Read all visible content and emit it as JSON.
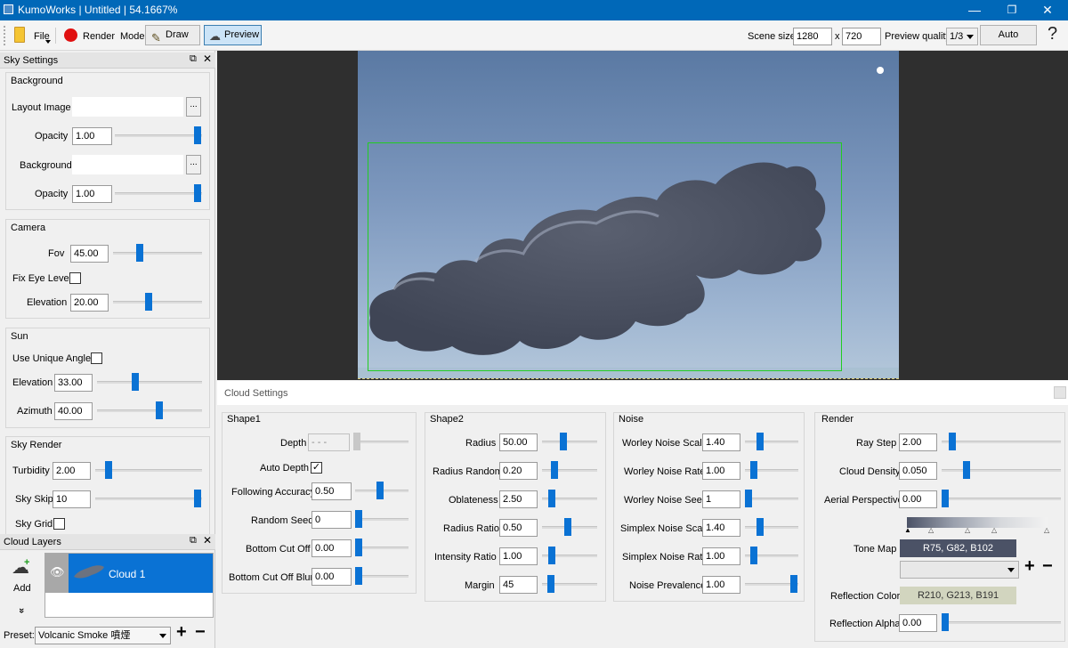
{
  "window": {
    "title": "KumoWorks | Untitled | 54.1667%",
    "minimize": "—",
    "restore": "❐",
    "close": "✕"
  },
  "toolbar": {
    "file": "File",
    "render": "Render",
    "mode_label": "Mode:",
    "draw": "Draw",
    "preview": "Preview",
    "scene_size_label": "Scene size:",
    "scene_width": "1280",
    "scene_x": "x",
    "scene_height": "720",
    "preview_quality_label": "Preview quality:",
    "preview_quality": "1/3",
    "auto": "Auto",
    "help": "?"
  },
  "sky_settings": {
    "title": "Sky Settings",
    "background": {
      "title": "Background",
      "layout_image_label": "Layout Image",
      "layout_image_value": "",
      "browse": "...",
      "opacity1_label": "Opacity",
      "opacity1": "1.00",
      "background_label": "Background",
      "background_value": "",
      "opacity2_label": "Opacity",
      "opacity2": "1.00"
    },
    "camera": {
      "title": "Camera",
      "fov_label": "Fov",
      "fov": "45.00",
      "fov_level": 0.28,
      "fix_eye_label": "Fix Eye Level",
      "fix_eye_checked": false,
      "elevation_label": "Elevation",
      "elevation": "20.00",
      "elevation_level": 0.36
    },
    "sun": {
      "title": "Sun",
      "unique_angles_label": "Use Unique Angles",
      "unique_angles_checked": false,
      "elevation_label": "Elevation",
      "elevation": "33.00",
      "elevation_level": 0.37,
      "azimuth_label": "Azimuth",
      "azimuth": "40.00",
      "azimuth_level": 0.59
    },
    "sky_render": {
      "title": "Sky Render",
      "turbidity_label": "Turbidity",
      "turbidity": "2.00",
      "turbidity_level": 0.1,
      "sky_skip_label": "Sky Skip",
      "sky_skip": "10",
      "sky_skip_level": 1.0,
      "sky_grid_label": "Sky Grid",
      "sky_grid_checked": false
    }
  },
  "cloud_layers": {
    "title": "Cloud Layers",
    "add_label": "Add",
    "expand": "»",
    "layers": [
      {
        "name": "Cloud 1",
        "visible": true
      }
    ],
    "preset_label": "Preset:",
    "preset_value": "Volcanic Smoke 噴煙",
    "plus": "+",
    "minus": "−"
  },
  "cloud_settings": {
    "title": "Cloud Settings",
    "shape1": {
      "title": "Shape1",
      "depth_label": "Depth",
      "depth": "- - -",
      "depth_level": 0.0,
      "auto_depth_label": "Auto Depth",
      "auto_depth_checked": true,
      "following_accuracy_label": "Following Accuracy",
      "following_accuracy": "0.50",
      "following_accuracy_level": 0.5,
      "random_seed_label": "Random Seed",
      "random_seed": "0",
      "random_seed_level": 0.0,
      "bottom_cut_off_label": "Bottom Cut Off",
      "bottom_cut_off": "0.00",
      "bottom_cut_off_level": 0.0,
      "bottom_cut_off_blur_label": "Bottom Cut Off Blur",
      "bottom_cut_off_blur": "0.00",
      "bottom_cut_off_blur_level": 0.0
    },
    "shape2": {
      "title": "Shape2",
      "radius_label": "Radius",
      "radius": "50.00",
      "radius_level": 0.46,
      "radius_random_label": "Radius Random",
      "radius_random": "0.20",
      "radius_random_level": 0.2,
      "oblateness_label": "Oblateness",
      "oblateness": "2.50",
      "oblateness_level": 0.16,
      "radius_ratio_label": "Radius Ratio",
      "radius_ratio": "0.50",
      "radius_ratio_level": 0.5,
      "intensity_ratio_label": "Intensity Ratio",
      "intensity_ratio": "1.00",
      "intensity_ratio_level": 0.16,
      "margin_label": "Margin",
      "margin": "45",
      "margin_level": 0.12
    },
    "noise": {
      "title": "Noise",
      "worley_scale_label": "Worley Noise Scale",
      "worley_scale": "1.40",
      "worley_scale_level": 0.28,
      "worley_rate_label": "Worley Noise Rate",
      "worley_rate": "1.00",
      "worley_rate_level": 0.17,
      "worley_seed_label": "Worley Noise Seed",
      "worley_seed": "1",
      "worley_seed_level": 0.02,
      "simplex_scale_label": "Simplex Noise Scale",
      "simplex_scale": "1.40",
      "simplex_scale_level": 0.28,
      "simplex_rate_label": "Simplex Noise Rate",
      "simplex_rate": "1.00",
      "simplex_rate_level": 0.17,
      "prevalence_label": "Noise Prevalence",
      "prevalence": "1.00",
      "prevalence_level": 1.0
    },
    "render": {
      "title": "Render",
      "ray_step_label": "Ray Step",
      "ray_step": "2.00",
      "ray_step_level": 0.1,
      "cloud_density_label": "Cloud Density",
      "cloud_density": "0.050",
      "cloud_density_level": 0.25,
      "aerial_perspective_label": "Aerial Perspective",
      "aerial_perspective": "0.00",
      "aerial_perspective_level": 0.0,
      "tone_map_label": "Tone Map",
      "tone_map_color": "R75, G82, B102",
      "tone_map_hex": "#4b5266",
      "reflection_color_label": "Reflection Color",
      "reflection_color": "R210, G213, B191",
      "reflection_hex": "#d2d5bf",
      "reflection_alpha_label": "Reflection Alpha",
      "reflection_alpha": "0.00",
      "reflection_alpha_level": 0.0,
      "plus": "+",
      "minus": "−"
    }
  },
  "colors": {
    "accent": "#0a72d4",
    "titlebar": "#0068b8",
    "selection_box": "#22cc22",
    "layer_selected": "#0a72d4"
  }
}
